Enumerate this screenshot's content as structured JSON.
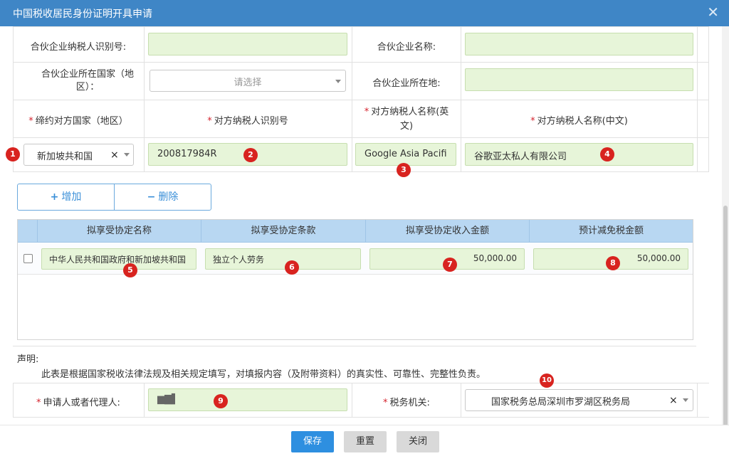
{
  "dialog": {
    "title": "中国税收居民身份证明开具申请",
    "close_label": "✕"
  },
  "partner": {
    "taxpayer_id_label": "合伙企业纳税人识别号:",
    "taxpayer_id_value": "",
    "name_label": "合伙企业名称:",
    "name_value": "",
    "country_label_line1": "合伙企业所在国家（地",
    "country_label_line2": "区）：",
    "country_placeholder": "请选择",
    "location_label": "合伙企业所在地:",
    "location_value": ""
  },
  "treaty_table": {
    "required_mark": "*",
    "headers": [
      "缔约对方国家（地区）",
      "对方纳税人识别号",
      "对方纳税人名称(英",
      "文)",
      "对方纳税人名称(中文)"
    ],
    "row": {
      "country": "新加坡共和国",
      "taxpayer_id": "200817984R",
      "name_en": "Google Asia Pacifi",
      "name_cn": "谷歌亚太私人有限公司"
    }
  },
  "actions": {
    "add_label": "增加",
    "delete_label": "删除",
    "add_icon": "+",
    "delete_icon": "−"
  },
  "agreement_table": {
    "headers": [
      "拟享受协定名称",
      "拟享受协定条款",
      "拟享受协定收入金额",
      "预计减免税金额"
    ],
    "rows": [
      {
        "name": "中华人民共和国政府和新加坡共和国",
        "clause": "独立个人劳务",
        "income": "50,000.00",
        "relief": "50,000.00"
      }
    ]
  },
  "declaration": {
    "title": "声明:",
    "text": "此表是根据国家税收法律法规及相关规定填写，对填报内容（及附带资料）的真实性、可靠性、完整性负责。"
  },
  "applicant": {
    "label": "申请人或者代理人:",
    "value": "▆▇▌",
    "tax_office_label": "税务机关:",
    "tax_office_value": "国家税务总局深圳市罗湖区税务局"
  },
  "footer": {
    "save": "保存",
    "reset": "重置",
    "close": "关闭"
  },
  "annotations": [
    "1",
    "2",
    "3",
    "4",
    "5",
    "6",
    "7",
    "8",
    "9",
    "10"
  ],
  "colors": {
    "titlebar": "#3f86c6",
    "field_bg": "#e7f5d9",
    "badge": "#d8231f",
    "header_blue": "#b8d7f2",
    "save_btn": "#2e8fe0"
  }
}
